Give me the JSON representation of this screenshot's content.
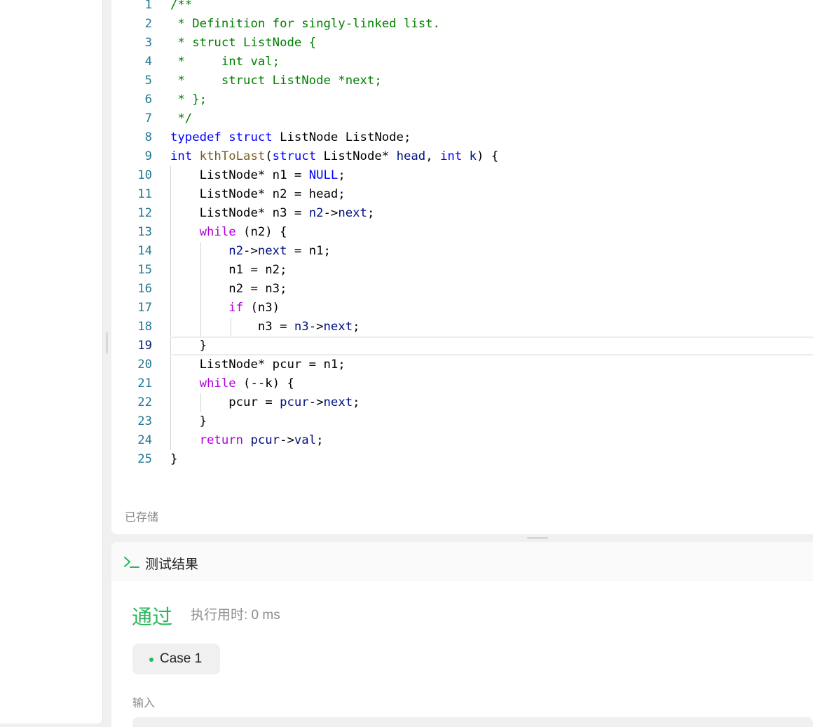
{
  "editor": {
    "lines": [
      {
        "n": "1",
        "indent": 0,
        "tokens": [
          {
            "t": "/**",
            "c": "comment"
          }
        ]
      },
      {
        "n": "2",
        "indent": 0,
        "tokens": [
          {
            "t": " * Definition for singly-linked list.",
            "c": "comment"
          }
        ]
      },
      {
        "n": "3",
        "indent": 0,
        "tokens": [
          {
            "t": " * struct ListNode {",
            "c": "comment"
          }
        ]
      },
      {
        "n": "4",
        "indent": 0,
        "tokens": [
          {
            "t": " *     int val;",
            "c": "comment"
          }
        ]
      },
      {
        "n": "5",
        "indent": 0,
        "tokens": [
          {
            "t": " *     struct ListNode *next;",
            "c": "comment"
          }
        ]
      },
      {
        "n": "6",
        "indent": 0,
        "tokens": [
          {
            "t": " * };",
            "c": "comment"
          }
        ]
      },
      {
        "n": "7",
        "indent": 0,
        "tokens": [
          {
            "t": " */",
            "c": "comment"
          }
        ]
      },
      {
        "n": "8",
        "indent": 0,
        "tokens": [
          {
            "t": "typedef",
            "c": "key"
          },
          {
            "t": " "
          },
          {
            "t": "struct",
            "c": "key"
          },
          {
            "t": " ListNode ListNode;"
          }
        ]
      },
      {
        "n": "9",
        "indent": 0,
        "tokens": [
          {
            "t": "int",
            "c": "key"
          },
          {
            "t": " "
          },
          {
            "t": "kthToLast",
            "c": "func"
          },
          {
            "t": "("
          },
          {
            "t": "struct",
            "c": "key"
          },
          {
            "t": " ListNode* "
          },
          {
            "t": "head",
            "c": "var"
          },
          {
            "t": ", "
          },
          {
            "t": "int",
            "c": "key"
          },
          {
            "t": " "
          },
          {
            "t": "k",
            "c": "var"
          },
          {
            "t": ") {"
          }
        ]
      },
      {
        "n": "10",
        "indent": 1,
        "tokens": [
          {
            "t": "    ListNode* n1 = "
          },
          {
            "t": "NULL",
            "c": "lit"
          },
          {
            "t": ";"
          }
        ]
      },
      {
        "n": "11",
        "indent": 1,
        "tokens": [
          {
            "t": "    ListNode* n2 = head;"
          }
        ]
      },
      {
        "n": "12",
        "indent": 1,
        "tokens": [
          {
            "t": "    ListNode* n3 = "
          },
          {
            "t": "n2",
            "c": "var"
          },
          {
            "t": "->"
          },
          {
            "t": "next",
            "c": "var"
          },
          {
            "t": ";"
          }
        ]
      },
      {
        "n": "13",
        "indent": 1,
        "tokens": [
          {
            "t": "    "
          },
          {
            "t": "while",
            "c": "ctrl"
          },
          {
            "t": " (n2) {"
          }
        ]
      },
      {
        "n": "14",
        "indent": 2,
        "tokens": [
          {
            "t": "        "
          },
          {
            "t": "n2",
            "c": "var"
          },
          {
            "t": "->"
          },
          {
            "t": "next",
            "c": "var"
          },
          {
            "t": " = n1;"
          }
        ]
      },
      {
        "n": "15",
        "indent": 2,
        "tokens": [
          {
            "t": "        n1 = n2;"
          }
        ]
      },
      {
        "n": "16",
        "indent": 2,
        "tokens": [
          {
            "t": "        n2 = n3;"
          }
        ]
      },
      {
        "n": "17",
        "indent": 2,
        "tokens": [
          {
            "t": "        "
          },
          {
            "t": "if",
            "c": "ctrl"
          },
          {
            "t": " (n3)"
          }
        ]
      },
      {
        "n": "18",
        "indent": 3,
        "tokens": [
          {
            "t": "            n3 = "
          },
          {
            "t": "n3",
            "c": "var"
          },
          {
            "t": "->"
          },
          {
            "t": "next",
            "c": "var"
          },
          {
            "t": ";"
          }
        ]
      },
      {
        "n": "19",
        "indent": 1,
        "current": true,
        "tokens": [
          {
            "t": "    }"
          }
        ]
      },
      {
        "n": "20",
        "indent": 1,
        "tokens": [
          {
            "t": "    ListNode* pcur = n1;"
          }
        ]
      },
      {
        "n": "21",
        "indent": 1,
        "tokens": [
          {
            "t": "    "
          },
          {
            "t": "while",
            "c": "ctrl"
          },
          {
            "t": " (--k) {"
          }
        ]
      },
      {
        "n": "22",
        "indent": 2,
        "tokens": [
          {
            "t": "        pcur = "
          },
          {
            "t": "pcur",
            "c": "var"
          },
          {
            "t": "->"
          },
          {
            "t": "next",
            "c": "var"
          },
          {
            "t": ";"
          }
        ]
      },
      {
        "n": "23",
        "indent": 1,
        "tokens": [
          {
            "t": "    }"
          }
        ]
      },
      {
        "n": "24",
        "indent": 1,
        "tokens": [
          {
            "t": "    "
          },
          {
            "t": "return",
            "c": "ctrl"
          },
          {
            "t": " "
          },
          {
            "t": "pcur",
            "c": "var"
          },
          {
            "t": "->"
          },
          {
            "t": "val",
            "c": "var"
          },
          {
            "t": ";"
          }
        ]
      },
      {
        "n": "25",
        "indent": 0,
        "tokens": [
          {
            "t": "}"
          }
        ]
      }
    ],
    "saved_label": "已存储"
  },
  "result": {
    "title": "测试结果",
    "status": "通过",
    "runtime": "执行用时: 0 ms",
    "case_tab": "Case 1",
    "input_label": "输入"
  },
  "icons": [
    "terminal-icon"
  ],
  "colors": {
    "success": "#2db55d",
    "comment": "#008000",
    "keyword": "#0000ff",
    "control": "#af00db",
    "function": "#795e26",
    "variable": "#001080",
    "line_number": "#237893"
  }
}
